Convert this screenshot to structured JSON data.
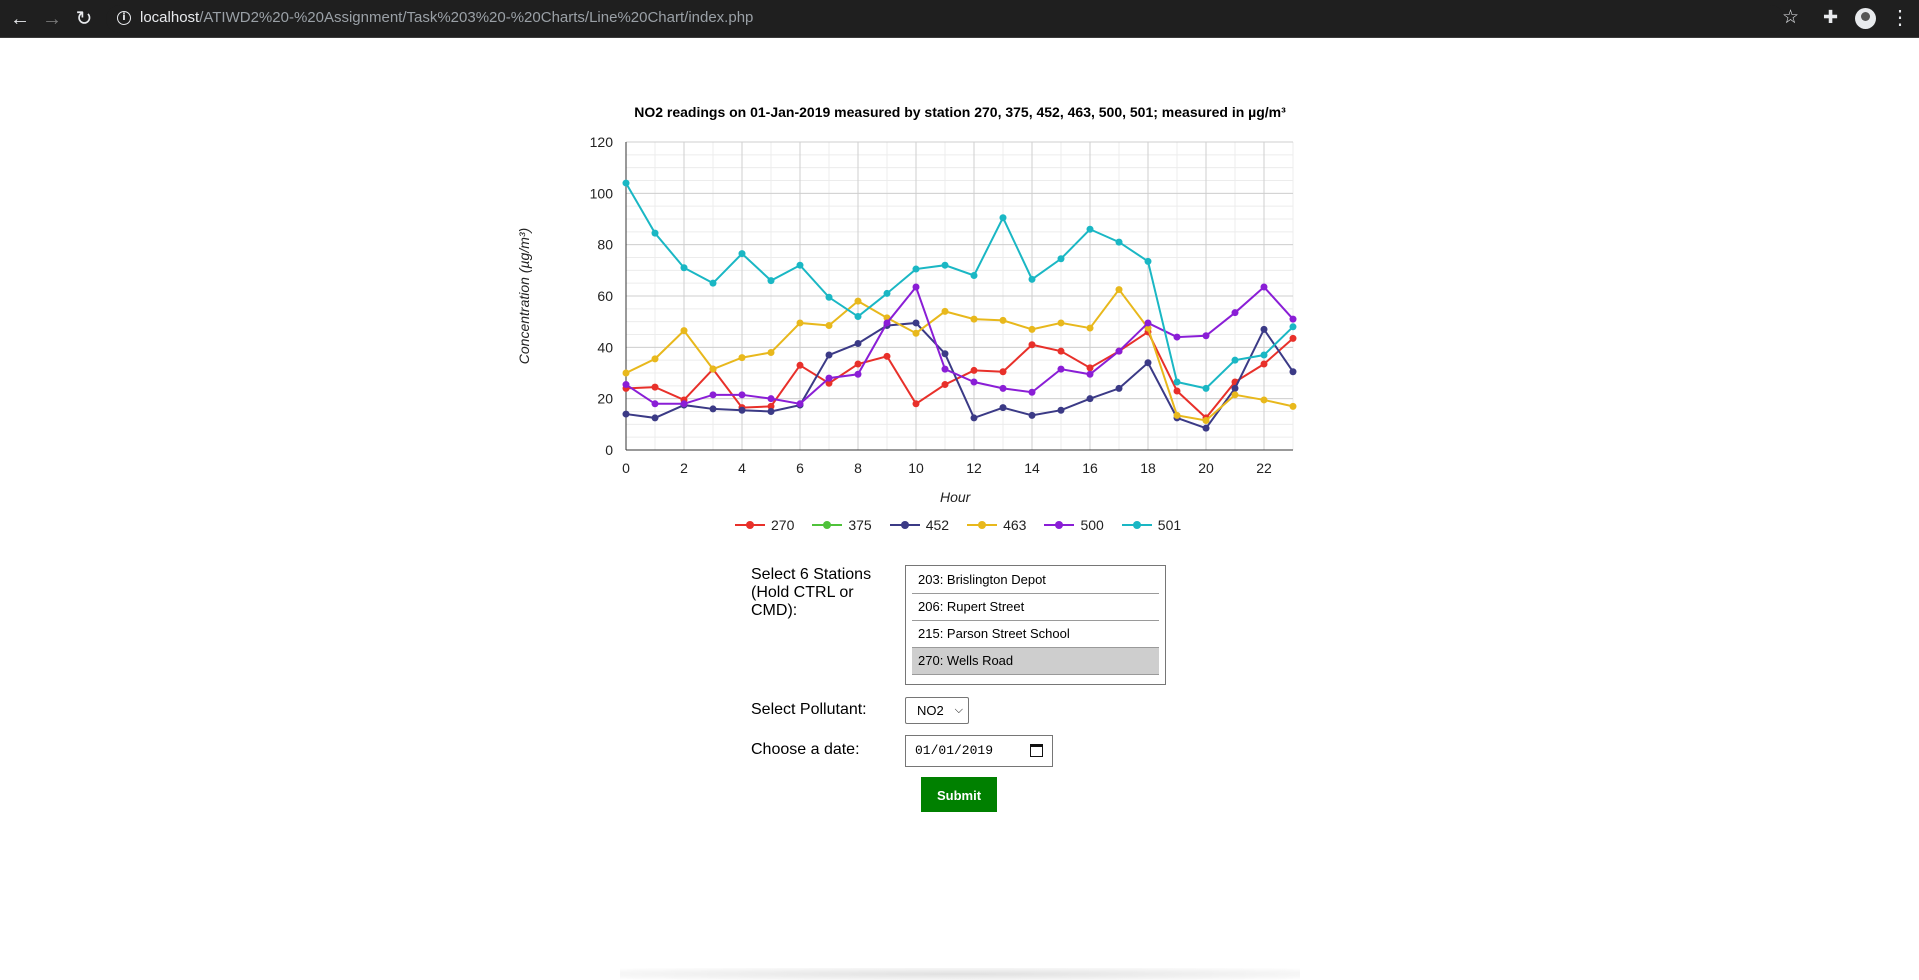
{
  "browser": {
    "back_icon": "←",
    "forward_icon": "→",
    "reload_icon": "↻",
    "url_host": "localhost",
    "url_path": "/ATIWD2%20-%20Assignment/Task%203%20-%20Charts/Line%20Chart/index.php",
    "star_icon": "☆",
    "extensions_icon": "✚",
    "menu_icon": "⋮"
  },
  "chart_data": {
    "type": "line",
    "title": "NO2 readings on 01-Jan-2019 measured by station 270, 375, 452, 463, 500, 501; measured in µg/m³",
    "xlabel": "Hour",
    "ylabel": "Concentration (µg/m³)",
    "x": [
      0,
      1,
      2,
      3,
      4,
      5,
      6,
      7,
      8,
      9,
      10,
      11,
      12,
      13,
      14,
      15,
      16,
      17,
      18,
      19,
      20,
      21,
      22,
      23
    ],
    "xlim": [
      0,
      23
    ],
    "ylim": [
      0,
      120
    ],
    "xticks": [
      0,
      2,
      4,
      6,
      8,
      10,
      12,
      14,
      16,
      18,
      20,
      22
    ],
    "yticks": [
      0,
      20,
      40,
      60,
      80,
      100,
      120
    ],
    "grid": true,
    "legend_position": "bottom",
    "series": [
      {
        "name": "270",
        "color": "#e8302a",
        "values": [
          24,
          24.5,
          19.5,
          31.5,
          16.5,
          17,
          33,
          26,
          33.5,
          36.5,
          18,
          25.5,
          31,
          30.5,
          41,
          38.5,
          32,
          38.5,
          46,
          23,
          12.5,
          26.5,
          33.5,
          43.5
        ]
      },
      {
        "name": "375",
        "color": "#4fc23a",
        "values": []
      },
      {
        "name": "452",
        "color": "#3b3a86",
        "values": [
          14,
          12.5,
          17.5,
          16,
          15.5,
          15,
          17.5,
          37,
          41.5,
          48.5,
          49.5,
          37.5,
          12.5,
          16.5,
          13.5,
          15.5,
          20,
          24,
          34,
          12.5,
          8.5,
          24,
          47,
          30.5
        ]
      },
      {
        "name": "463",
        "color": "#e8b81c",
        "values": [
          30,
          35.5,
          46.5,
          31.5,
          36,
          38,
          49.5,
          48.5,
          58,
          51.5,
          45.5,
          54,
          51,
          50.5,
          47,
          49.5,
          47.5,
          62.5,
          47.5,
          13.5,
          11.5,
          21.5,
          19.5,
          17
        ]
      },
      {
        "name": "500",
        "color": "#8a1ed6",
        "values": [
          25.5,
          18,
          18,
          21.5,
          21.5,
          20,
          18,
          28,
          29.5,
          49.5,
          63.5,
          31.5,
          26.5,
          24,
          22.5,
          31.5,
          29.5,
          38.5,
          49.5,
          44,
          44.5,
          53.5,
          63.5,
          51
        ]
      },
      {
        "name": "501",
        "color": "#1ab7c4",
        "values": [
          104,
          84.5,
          71,
          65,
          76.5,
          66,
          72,
          59.5,
          52,
          61,
          70.5,
          72,
          68,
          90.5,
          66.5,
          74.5,
          86,
          81,
          73.5,
          26.5,
          24,
          35,
          37,
          48
        ]
      }
    ]
  },
  "form": {
    "stations_label": "Select 6 Stations (Hold CTRL or CMD):",
    "stations_options": [
      "203: Brislington Depot",
      "206: Rupert Street",
      "215: Parson Street School",
      "270: Wells Road"
    ],
    "stations_selected_index": 3,
    "pollutant_label": "Select Pollutant:",
    "pollutant_value": "NO2",
    "date_label": "Choose a date:",
    "date_value": "01/01/2019",
    "submit_label": "Submit"
  }
}
